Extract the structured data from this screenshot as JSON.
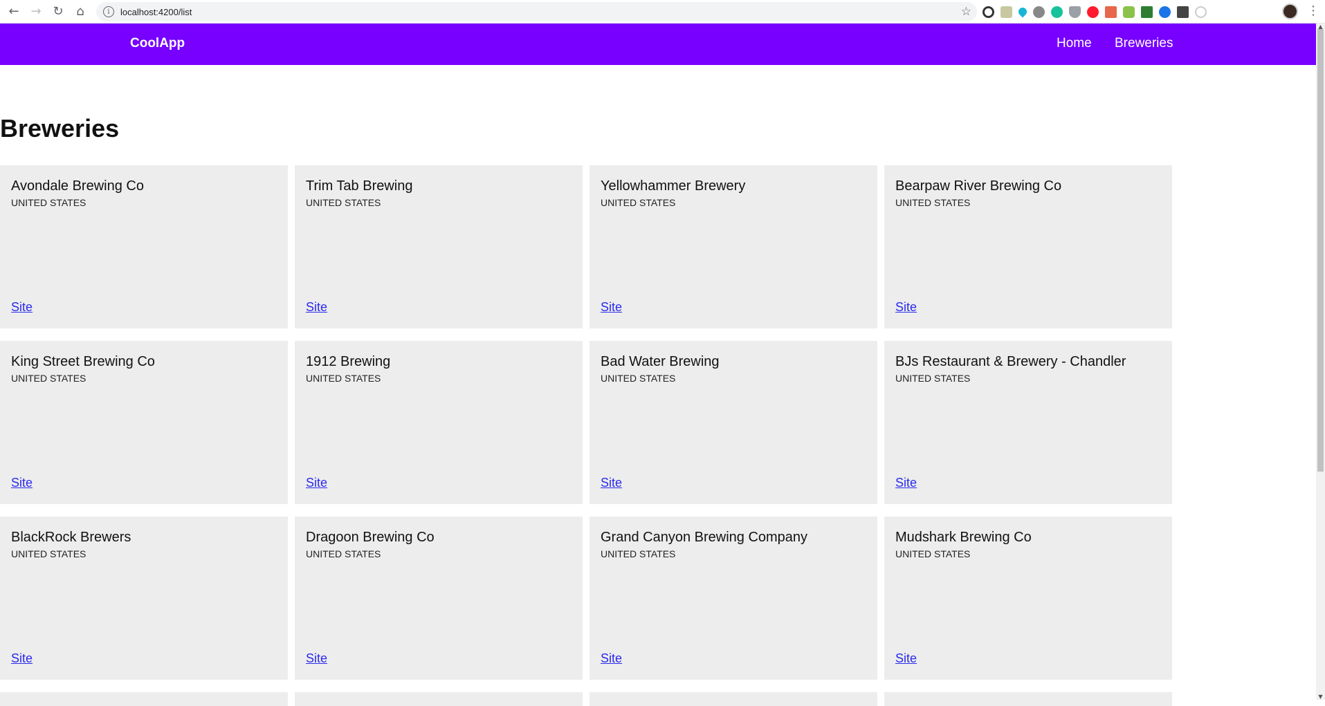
{
  "browser": {
    "url": "localhost:4200/list"
  },
  "navbar": {
    "brand": "CoolApp",
    "links": [
      "Home",
      "Breweries"
    ],
    "color": "#7700ff"
  },
  "page": {
    "title": "Breweries"
  },
  "breweries": [
    {
      "name": "Avondale Brewing Co",
      "country": "UNITED STATES",
      "link": "Site"
    },
    {
      "name": "Trim Tab Brewing",
      "country": "UNITED STATES",
      "link": "Site"
    },
    {
      "name": "Yellowhammer Brewery",
      "country": "UNITED STATES",
      "link": "Site"
    },
    {
      "name": "Bearpaw River Brewing Co",
      "country": "UNITED STATES",
      "link": "Site"
    },
    {
      "name": "King Street Brewing Co",
      "country": "UNITED STATES",
      "link": "Site"
    },
    {
      "name": "1912 Brewing",
      "country": "UNITED STATES",
      "link": "Site"
    },
    {
      "name": "Bad Water Brewing",
      "country": "UNITED STATES",
      "link": "Site"
    },
    {
      "name": "BJs Restaurant & Brewery - Chandler",
      "country": "UNITED STATES",
      "link": "Site"
    },
    {
      "name": "BlackRock Brewers",
      "country": "UNITED STATES",
      "link": "Site"
    },
    {
      "name": "Dragoon Brewing Co",
      "country": "UNITED STATES",
      "link": "Site"
    },
    {
      "name": "Grand Canyon Brewing Company",
      "country": "UNITED STATES",
      "link": "Site"
    },
    {
      "name": "Mudshark Brewing Co",
      "country": "UNITED STATES",
      "link": "Site"
    }
  ]
}
